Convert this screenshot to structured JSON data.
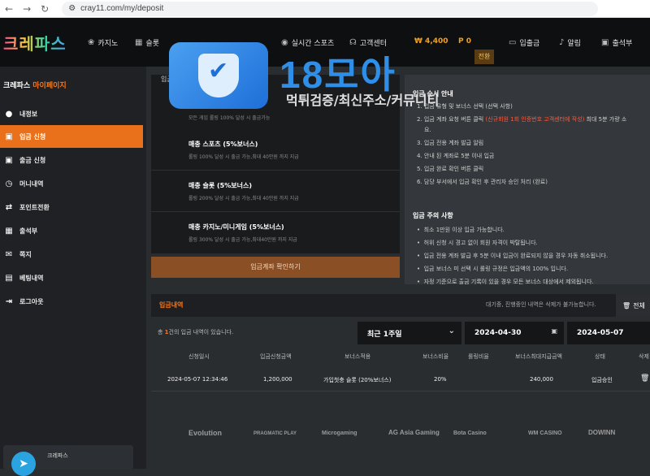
{
  "browser": {
    "url": "cray11.com/my/deposit",
    "back": "←",
    "forward": "→",
    "reload": "↻"
  },
  "topnav": {
    "logo": "크레파스",
    "items": [
      "카지노",
      "슬롯",
      "실시간 스포츠",
      "고객센터"
    ],
    "balance": "₩ 4,400",
    "points": "P 0",
    "charge": "전환",
    "deposit": "입출금",
    "alerts": "알림",
    "attendance": "출석부"
  },
  "sidebar": {
    "title_main": "크레파스",
    "title_hl": "마이페이지",
    "items": [
      {
        "label": "내정보",
        "icon": "user-icon"
      },
      {
        "label": "입금 신청",
        "icon": "deposit-icon"
      },
      {
        "label": "출금 신청",
        "icon": "withdraw-icon"
      },
      {
        "label": "머니내역",
        "icon": "clock-icon"
      },
      {
        "label": "포인트전환",
        "icon": "swap-icon"
      },
      {
        "label": "출석부",
        "icon": "calendar-icon"
      },
      {
        "label": "쪽지",
        "icon": "mail-icon"
      },
      {
        "label": "베팅내역",
        "icon": "document-icon"
      },
      {
        "label": "로그아웃",
        "icon": "logout-icon"
      }
    ],
    "telegram_label": "크레파스"
  },
  "bonus_panel": {
    "head": "입금",
    "top_desc": "모든 게임 롤링 100% 달성 시 출금가능",
    "rows": [
      {
        "title": "매충 스포츠 (5%보너스)",
        "desc": "롤링 100% 달성 시 출금 가능,최대 40만원 까지 지급"
      },
      {
        "title": "매충 슬롯 (5%보너스)",
        "desc": "롤링 200% 달성 시 출금 가능,최대 40만원 까지 지급"
      },
      {
        "title": "매충 카지노/미니게임 (5%보너스)",
        "desc": "롤링 300% 달성 시 출금 가능,최대40만원 까지 지급"
      }
    ],
    "confirm_button": "입금계좌 확인하기"
  },
  "guide": {
    "title": "입금 순서 안내",
    "steps": [
      "1. 입금 유형 및 보너스 선택 (선택 사항)",
      "2. 입금 계좌 요청 버튼 클릭",
      "(신규회원 1회 인증번호 고객센터에 작성)",
      "최대 5분 가량 소",
      "요.",
      "3. 입금 전용 계좌 발급 알림",
      "4. 안내 된 계좌로 5분 이내 입금",
      "5. 입금 완료 확인 버튼 클릭",
      "6. 담당 부서에서 입금 확인 후 관리자 승인 처리 (완료)"
    ],
    "notes_title": "입금 주의 사항",
    "notes": [
      "최소 1만원 이상 입금 가능합니다.",
      "허위 신청 시 경고 없이 회원 자격이 박탈됩니다.",
      "입금 전용 계좌 발급 후 5분 이내 입금이 완료되지 않을 경우 자동 취소됩니다.",
      "입금 보너스 미 선택 시 롤링 규정은 입금액의 100% 입니다.",
      "자정 기준으로 출금 기록이 있을 경우 모든 보너스 대상에서 제외됩니다."
    ]
  },
  "history": {
    "title": "입금내역",
    "note": "대기중, 진행중인 내역은 삭제가 불가능합니다.",
    "delete_all": "전체",
    "count_prefix": "총 ",
    "count": "1",
    "count_suffix": "건의 입금 내역이 있습니다.",
    "period": "최근 1주일",
    "date_from": "2024-04-30",
    "date_to": "2024-05-07",
    "columns": [
      "신청일시",
      "입금신청금액",
      "보너스적용",
      "보너스비율",
      "롤링비율",
      "보너스최대지급금액",
      "상태",
      "삭제"
    ],
    "row": {
      "date": "2024-05-07 12:34:46",
      "amount": "1,200,000",
      "bonus": "가입첫충 슬롯 (20%보너스)",
      "rate": "20%",
      "rolling": "",
      "max": "240,000",
      "status": "입금승인"
    }
  },
  "providers": [
    "Evolution",
    "PRAGMATIC PLAY",
    "Microgaming",
    "AG Asia Gaming",
    "Bota Casino",
    "WM CASINO",
    "DOWINN"
  ],
  "watermark": {
    "text": "18모아",
    "sub": "먹튀검증/최신주소/커뮤니티"
  },
  "colors": {
    "accent": "#e9711c",
    "bg": "#2a2d30",
    "sidebar": "#1f2124"
  }
}
